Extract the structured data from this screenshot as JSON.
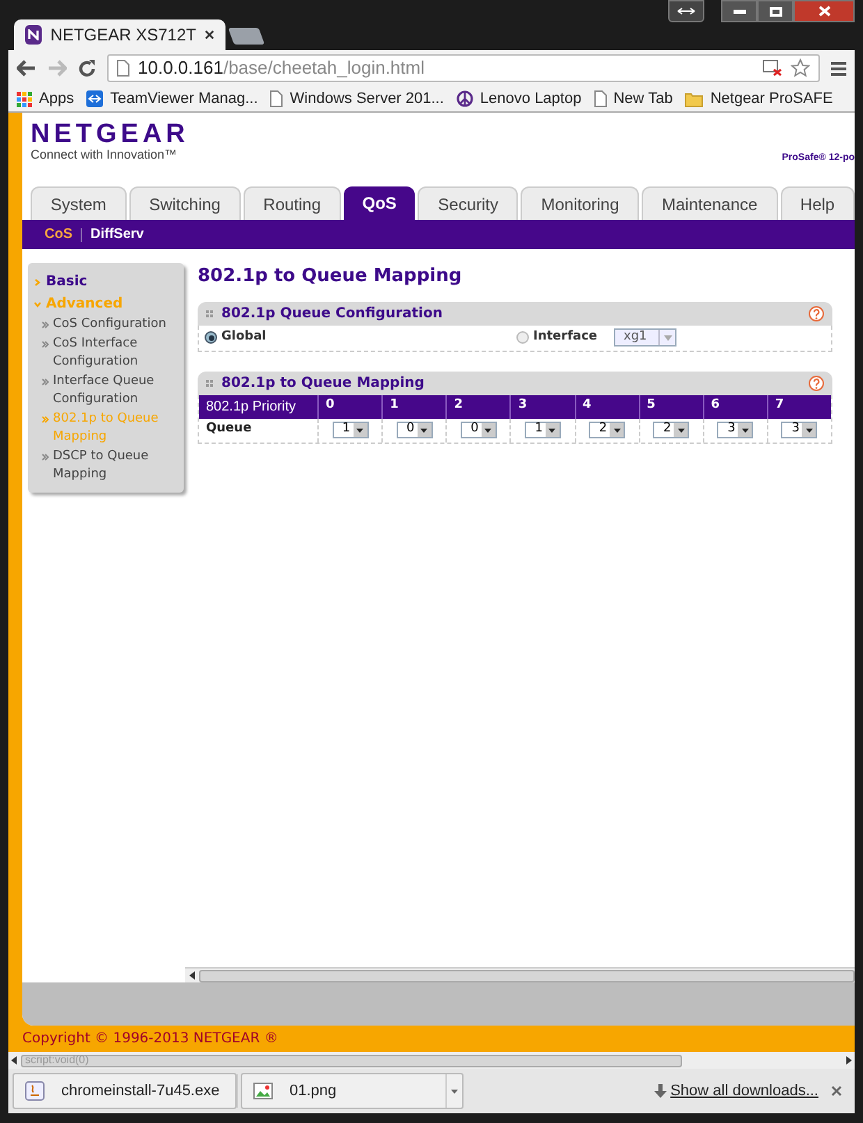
{
  "browser": {
    "tab_title": "NETGEAR XS712T",
    "url_host": "10.0.0.161",
    "url_path": "/base/cheetah_login.html",
    "bookmarks": [
      {
        "label": "Apps",
        "kind": "apps"
      },
      {
        "label": "TeamViewer Manag...",
        "kind": "teamviewer"
      },
      {
        "label": "Windows Server 201...",
        "kind": "page"
      },
      {
        "label": "Lenovo Laptop",
        "kind": "peace"
      },
      {
        "label": "New Tab",
        "kind": "page"
      },
      {
        "label": "Netgear ProSAFE",
        "kind": "folder"
      }
    ]
  },
  "header": {
    "logo": "NETGEAR",
    "tagline": "Connect with Innovation™",
    "product": "ProSafe® 12-po"
  },
  "tabs": [
    {
      "label": "System",
      "selected": false
    },
    {
      "label": "Switching",
      "selected": false
    },
    {
      "label": "Routing",
      "selected": false
    },
    {
      "label": "QoS",
      "selected": true
    },
    {
      "label": "Security",
      "selected": false
    },
    {
      "label": "Monitoring",
      "selected": false
    },
    {
      "label": "Maintenance",
      "selected": false
    },
    {
      "label": "Help",
      "selected": false
    }
  ],
  "subtabs": [
    {
      "label": "CoS",
      "selected": true
    },
    {
      "label": "DiffServ",
      "selected": false
    }
  ],
  "sidebar": [
    {
      "label": "Basic",
      "expanded": false,
      "selected": false
    },
    {
      "label": "Advanced",
      "expanded": true,
      "selected": true,
      "children": [
        {
          "label": "CoS Configuration",
          "selected": false
        },
        {
          "label": "CoS Interface Configuration",
          "selected": false
        },
        {
          "label": "Interface Queue Configuration",
          "selected": false
        },
        {
          "label": "802.1p to Queue Mapping",
          "selected": true
        },
        {
          "label": "DSCP to Queue Mapping",
          "selected": false
        }
      ]
    }
  ],
  "page_title": "802.1p to Queue Mapping",
  "config_panel": {
    "title": "802.1p Queue Configuration",
    "options": [
      {
        "label": "Global",
        "selected": true
      },
      {
        "label": "Interface",
        "selected": false
      }
    ],
    "interface_select": "xg1"
  },
  "mapping_panel": {
    "title": "802.1p to Queue Mapping",
    "priority_header": "802.1p Priority",
    "queue_header": "Queue",
    "columns": [
      {
        "priority": "0",
        "queue": "1"
      },
      {
        "priority": "1",
        "queue": "0"
      },
      {
        "priority": "2",
        "queue": "0"
      },
      {
        "priority": "3",
        "queue": "1"
      },
      {
        "priority": "4",
        "queue": "2"
      },
      {
        "priority": "5",
        "queue": "2"
      },
      {
        "priority": "6",
        "queue": "3"
      },
      {
        "priority": "7",
        "queue": "3"
      }
    ]
  },
  "footer": {
    "copyright": "Copyright © 1996-2013 NETGEAR ®"
  },
  "status_bubble": "script:void(0)",
  "downloads": {
    "items": [
      {
        "name": "chromeinstall-7u45.exe",
        "kind": "exe"
      },
      {
        "name": "01.png",
        "kind": "image"
      }
    ],
    "show_all": "Show all downloads..."
  }
}
